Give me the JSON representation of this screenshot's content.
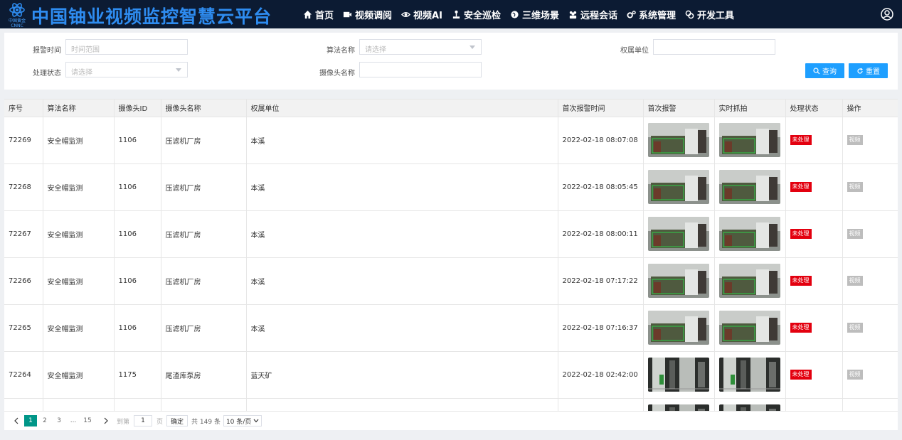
{
  "header": {
    "logo_text": "中国黄金 CNNC",
    "title": "中国铀业视频监控智慧云平台",
    "nav": [
      {
        "label": "首页",
        "icon": "home-icon"
      },
      {
        "label": "视频调阅",
        "icon": "video-camera-icon"
      },
      {
        "label": "视频AI",
        "icon": "eye-icon"
      },
      {
        "label": "安全巡检",
        "icon": "joystick-icon"
      },
      {
        "label": "三维场景",
        "icon": "globe-icon"
      },
      {
        "label": "远程会话",
        "icon": "users-icon"
      },
      {
        "label": "系统管理",
        "icon": "gears-icon"
      },
      {
        "label": "开发工具",
        "icon": "tools-icon"
      }
    ],
    "user_icon": "user-circle-icon"
  },
  "filters": {
    "alarm_time": {
      "label": "报警时间",
      "placeholder": "时间范围"
    },
    "algorithm": {
      "label": "算法名称",
      "placeholder": "请选择"
    },
    "owner_unit": {
      "label": "权属单位",
      "value": ""
    },
    "status": {
      "label": "处理状态",
      "placeholder": "请选择"
    },
    "camera_name": {
      "label": "摄像头名称",
      "value": ""
    },
    "search_button": "查询",
    "reset_button": "重置"
  },
  "table": {
    "columns": [
      "序号",
      "算法名称",
      "摄像头ID",
      "摄像头名称",
      "权属单位",
      "首次报警时间",
      "首次报警",
      "实时抓拍",
      "处理状态",
      "操作"
    ],
    "rows": [
      {
        "id": "72269",
        "algo": "安全帽监测",
        "cam_id": "1106",
        "cam_name": "压滤机厂房",
        "unit": "本溪",
        "time": "2022-02-18 08:07:08",
        "status": "未处理",
        "action": "视频",
        "scene": "a"
      },
      {
        "id": "72268",
        "algo": "安全帽监测",
        "cam_id": "1106",
        "cam_name": "压滤机厂房",
        "unit": "本溪",
        "time": "2022-02-18 08:05:45",
        "status": "未处理",
        "action": "视频",
        "scene": "a"
      },
      {
        "id": "72267",
        "algo": "安全帽监测",
        "cam_id": "1106",
        "cam_name": "压滤机厂房",
        "unit": "本溪",
        "time": "2022-02-18 08:00:11",
        "status": "未处理",
        "action": "视频",
        "scene": "a"
      },
      {
        "id": "72266",
        "algo": "安全帽监测",
        "cam_id": "1106",
        "cam_name": "压滤机厂房",
        "unit": "本溪",
        "time": "2022-02-18 07:17:22",
        "status": "未处理",
        "action": "视频",
        "scene": "a"
      },
      {
        "id": "72265",
        "algo": "安全帽监测",
        "cam_id": "1106",
        "cam_name": "压滤机厂房",
        "unit": "本溪",
        "time": "2022-02-18 07:16:37",
        "status": "未处理",
        "action": "视频",
        "scene": "a"
      },
      {
        "id": "72264",
        "algo": "安全帽监测",
        "cam_id": "1175",
        "cam_name": "尾渣库泵房",
        "unit": "蓝天矿",
        "time": "2022-02-18 02:42:00",
        "status": "未处理",
        "action": "视频",
        "scene": "b"
      },
      {
        "id": "",
        "algo": "",
        "cam_id": "",
        "cam_name": "",
        "unit": "",
        "time": "",
        "status": "",
        "action": "",
        "scene": "b"
      }
    ]
  },
  "pagination": {
    "prev": "<",
    "pages": [
      "1",
      "2",
      "3",
      "...",
      "15"
    ],
    "active_page": "1",
    "next": ">",
    "goto_prefix": "到第",
    "goto_value": "1",
    "goto_suffix": "页",
    "confirm": "确定",
    "total": "共 149 条",
    "page_size": "10 条/页"
  },
  "colors": {
    "header_bg": "#0c1b33",
    "title": "#2e8cf0",
    "primary_button": "#1e9fff",
    "pager_active": "#009688",
    "status_unprocessed": "#e3000f",
    "action_badge": "#bdbdbd"
  }
}
